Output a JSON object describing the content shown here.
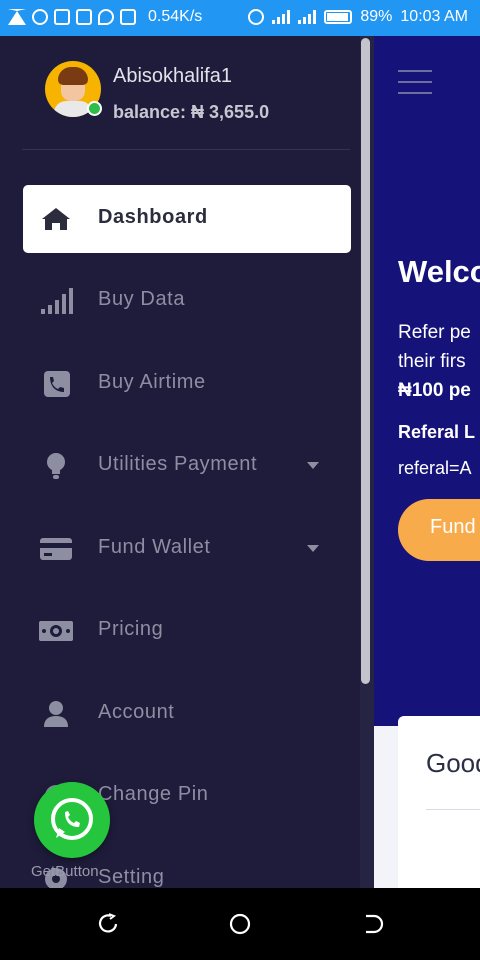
{
  "status_bar": {
    "net_speed": "0.54K/s",
    "battery": "89%",
    "time": "10:03 AM"
  },
  "user": {
    "name": "Abisokhalifa1",
    "balance": "balance: ₦ 3,655.0",
    "online": true
  },
  "menu": [
    {
      "label": "Dashboard",
      "icon": "home-icon",
      "active": true,
      "has_submenu": false
    },
    {
      "label": "Buy Data",
      "icon": "signal-icon",
      "active": false,
      "has_submenu": false
    },
    {
      "label": "Buy Airtime",
      "icon": "phone-icon",
      "active": false,
      "has_submenu": false
    },
    {
      "label": "Utilities Payment",
      "icon": "lightbulb-icon",
      "active": false,
      "has_submenu": true
    },
    {
      "label": "Fund Wallet",
      "icon": "credit-card-icon",
      "active": false,
      "has_submenu": true
    },
    {
      "label": "Pricing",
      "icon": "money-bill-icon",
      "active": false,
      "has_submenu": false
    },
    {
      "label": "Account",
      "icon": "user-icon",
      "active": false,
      "has_submenu": false
    },
    {
      "label": "Change Pin",
      "icon": "cog-icon",
      "active": false,
      "has_submenu": false
    },
    {
      "label": "Setting",
      "icon": "settings-icon",
      "active": false,
      "has_submenu": false
    }
  ],
  "main": {
    "welcome": "Welco",
    "refer_lines": [
      "Refer pe",
      "their firs",
      "₦100 pe"
    ],
    "referal_label": "Referal L",
    "referal_link": "referal=A",
    "fund_button": "Fund",
    "card_title": "Good"
  },
  "whatsapp": {
    "label": "GetButton"
  },
  "colors": {
    "status_bar": "#2196f3",
    "drawer_bg": "#1e1c3a",
    "main_bg": "#15127a",
    "accent": "#f7ab4b",
    "whatsapp": "#25c63d"
  }
}
